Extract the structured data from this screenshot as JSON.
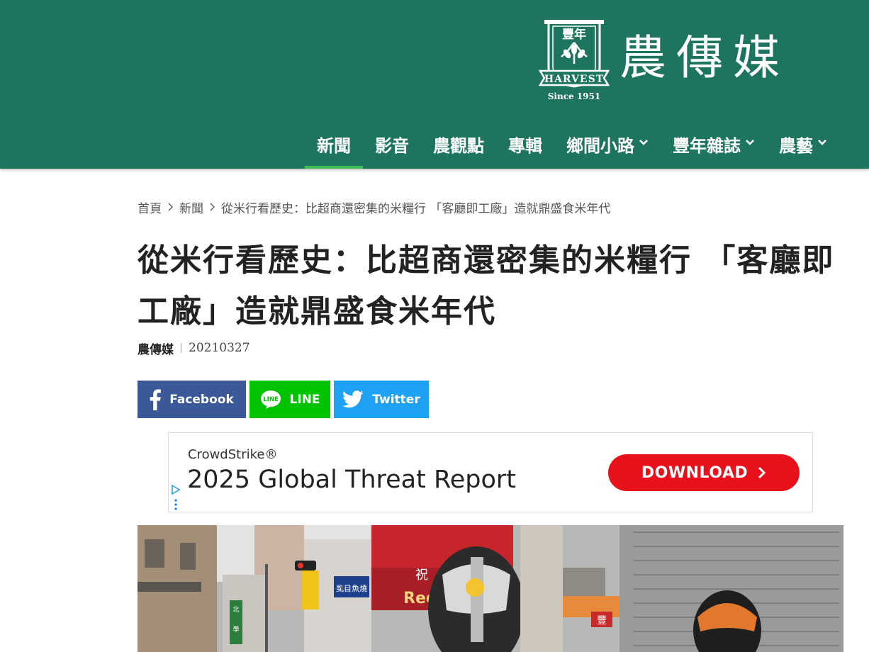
{
  "colors": {
    "header_bg": "#1d7560",
    "active_underline": "#3fbd50",
    "facebook": "#3b5998",
    "line": "#00c300",
    "twitter": "#1da1f2",
    "ad_cta": "#e8111b"
  },
  "logo": {
    "emblem_top": "豐年",
    "emblem_word": "HARVEST",
    "emblem_since": "Since 1951",
    "brand_text": "農傳媒"
  },
  "nav": {
    "items": [
      {
        "label": "新聞",
        "active": true,
        "dropdown": false,
        "icon": null
      },
      {
        "label": "影音",
        "active": false,
        "dropdown": false,
        "icon": null
      },
      {
        "label": "農觀點",
        "active": false,
        "dropdown": false,
        "icon": null
      },
      {
        "label": "專輯",
        "active": false,
        "dropdown": false,
        "icon": null
      },
      {
        "label": "鄉間小路",
        "active": false,
        "dropdown": true,
        "icon": "chevron-down-icon"
      },
      {
        "label": "豐年雜誌",
        "active": false,
        "dropdown": true,
        "icon": "chevron-down-icon"
      },
      {
        "label": "農藝",
        "active": false,
        "dropdown": true,
        "icon": "chevron-down-icon"
      }
    ]
  },
  "breadcrumb": {
    "home": "首頁",
    "section": "新聞",
    "current": "從米行看歷史：比超商還密集的米糧行 「客廳即工廠」造就鼎盛食米年代"
  },
  "article": {
    "title": "從米行看歷史：比超商還密集的米糧行 「客廳即工廠」造就鼎盛食米年代",
    "author": "農傳媒",
    "date": "20210327"
  },
  "share": {
    "facebook_label": "Facebook",
    "line_label": "LINE",
    "line_icon_text": "LINE",
    "twitter_label": "Twitter"
  },
  "ad": {
    "brand": "CrowdStrike®",
    "headline": "2025 Global Threat Report",
    "cta_label": "DOWNLOAD"
  },
  "photo": {
    "signs": [
      "虱目魚燒",
      "Red",
      "祝",
      "豐",
      "北",
      "學"
    ]
  }
}
